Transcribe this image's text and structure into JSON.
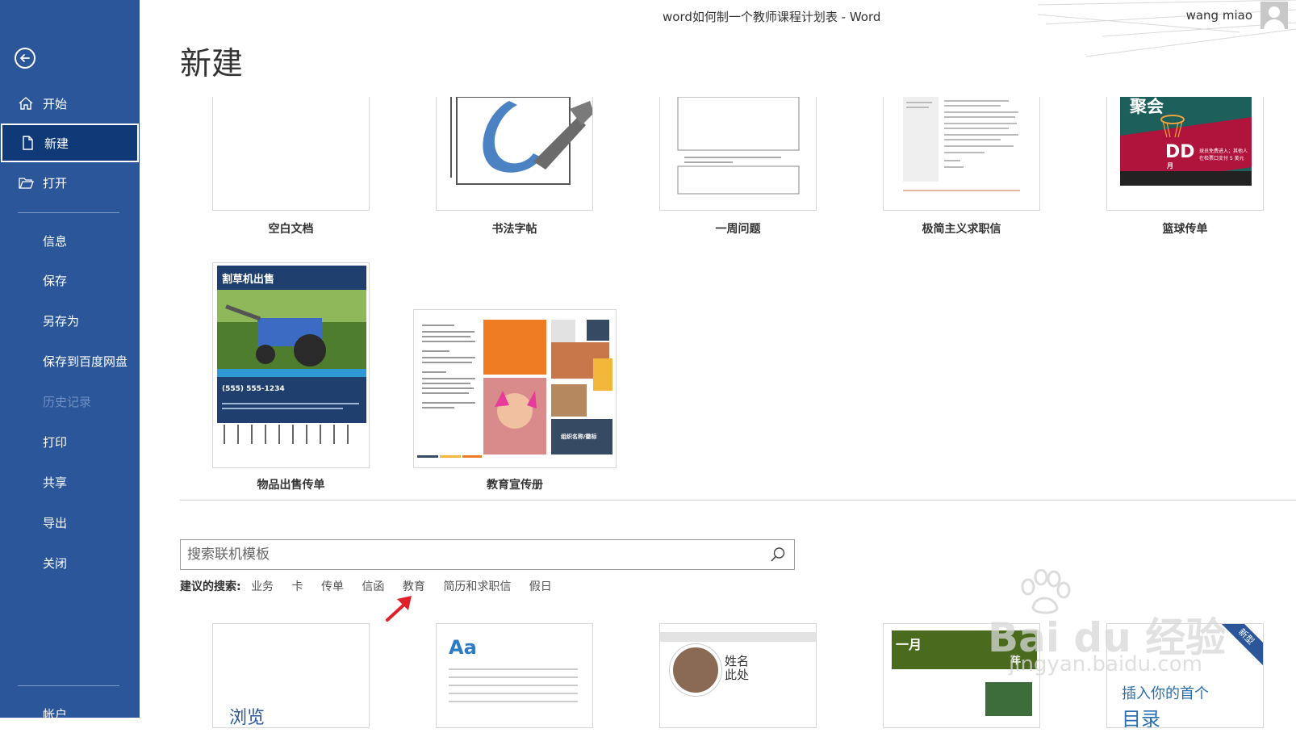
{
  "titlebar": {
    "doc_title": "word如何制一个教师课程计划表  -  Word",
    "user_name": "wang miao"
  },
  "sidebar": {
    "items": [
      {
        "label": "开始",
        "icon": "home-icon"
      },
      {
        "label": "新建",
        "icon": "new-document-icon"
      },
      {
        "label": "打开",
        "icon": "open-folder-icon"
      },
      {
        "label": "信息"
      },
      {
        "label": "保存"
      },
      {
        "label": "另存为"
      },
      {
        "label": "保存到百度网盘"
      },
      {
        "label": "历史记录"
      },
      {
        "label": "打印"
      },
      {
        "label": "共享"
      },
      {
        "label": "导出"
      },
      {
        "label": "关闭"
      },
      {
        "label": "帐户"
      }
    ]
  },
  "main": {
    "title": "新建",
    "featured_templates": [
      {
        "label": "空白文档"
      },
      {
        "label": "书法字帖"
      },
      {
        "label": "一周问题"
      },
      {
        "label": "极简主义求职信"
      },
      {
        "label": "篮球传单",
        "thumb_text": [
          "聚会",
          "DD",
          "月",
          "球员免费进入；其他人",
          "在检票口支付 5 美元"
        ]
      },
      {
        "label": "物品出售传单",
        "thumb_text": [
          "割草机出售",
          "(555) 555-1234"
        ]
      },
      {
        "label": "教育宣传册",
        "thumb_text": [
          "组织名称/徽标"
        ]
      }
    ],
    "search": {
      "placeholder": "搜索联机模板",
      "suggest_label": "建议的搜索:",
      "suggestions": [
        "业务",
        "卡",
        "传单",
        "信函",
        "教育",
        "简历和求职信",
        "假日"
      ]
    },
    "online_templates": [
      {
        "thumb_text": "浏览"
      },
      {
        "thumb_text": "Aa"
      },
      {
        "thumb_text": [
          "姓名",
          "此处"
        ]
      },
      {
        "thumb_text": [
          "一月",
          "年"
        ]
      },
      {
        "thumb_text": [
          "插入你的首个",
          "目录"
        ],
        "badge": "新型"
      }
    ]
  },
  "colors": {
    "sidebar": "#2b579a",
    "sidebar_active": "#0f3a77",
    "annotation_arrow": "#e0202a"
  },
  "watermark": {
    "brand": "Bai du 经验",
    "url": "jingyan.baidu.com"
  }
}
